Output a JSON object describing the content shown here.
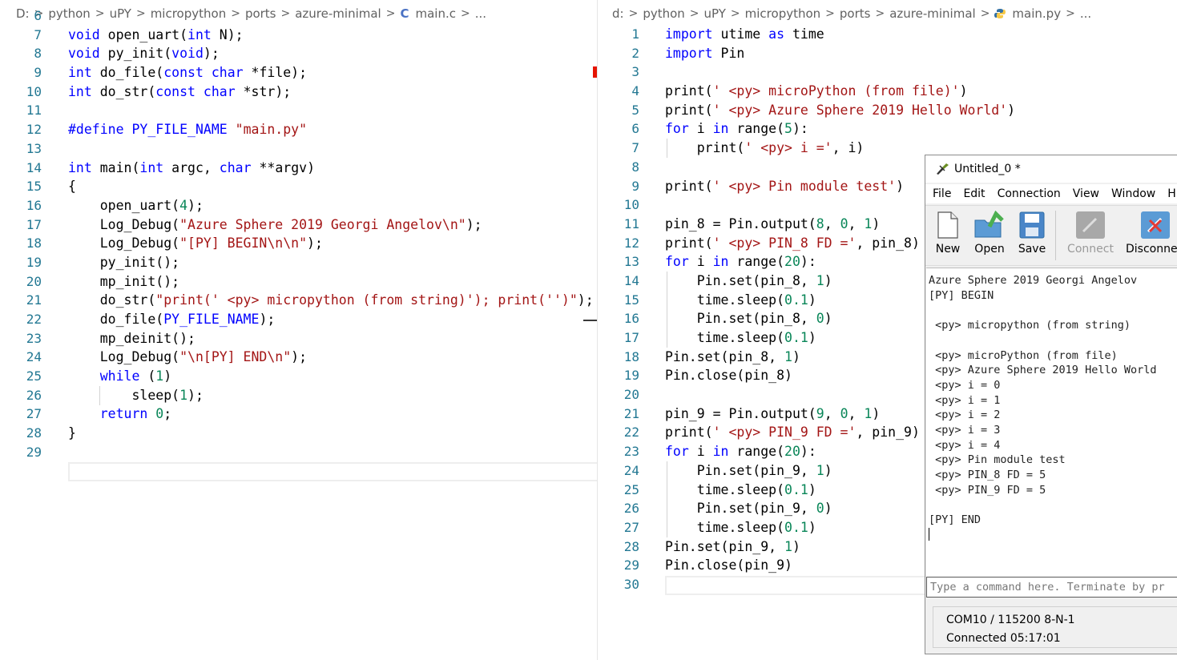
{
  "left": {
    "breadcrumb": [
      "D:",
      "python",
      "uPY",
      "micropython",
      "ports",
      "azure-minimal",
      "main.c",
      "..."
    ],
    "file_icon": "C",
    "lines": [
      {
        "n": "6",
        "t": ""
      },
      {
        "n": "7",
        "t": "void open_uart(int N);"
      },
      {
        "n": "8",
        "t": "void py_init(void);"
      },
      {
        "n": "9",
        "t": "int do_file(const char *file);"
      },
      {
        "n": "10",
        "t": "int do_str(const char *str);"
      },
      {
        "n": "11",
        "t": ""
      },
      {
        "n": "12",
        "t": "#define PY_FILE_NAME \"main.py\""
      },
      {
        "n": "13",
        "t": ""
      },
      {
        "n": "14",
        "t": "int main(int argc, char **argv)"
      },
      {
        "n": "15",
        "t": "{"
      },
      {
        "n": "16",
        "t": "    open_uart(4);"
      },
      {
        "n": "17",
        "t": "    Log_Debug(\"Azure Sphere 2019 Georgi Angelov\\n\");"
      },
      {
        "n": "18",
        "t": "    Log_Debug(\"[PY] BEGIN\\n\\n\");"
      },
      {
        "n": "19",
        "t": "    py_init();"
      },
      {
        "n": "20",
        "t": "    mp_init();"
      },
      {
        "n": "21",
        "t": "    do_str(\"print(' <py> micropython (from string)'); print('')\");"
      },
      {
        "n": "22",
        "t": "    do_file(PY_FILE_NAME);"
      },
      {
        "n": "23",
        "t": "    mp_deinit();"
      },
      {
        "n": "24",
        "t": "    Log_Debug(\"\\n[PY] END\\n\");"
      },
      {
        "n": "25",
        "t": "    while (1)"
      },
      {
        "n": "26",
        "t": "        sleep(1);"
      },
      {
        "n": "27",
        "t": "    return 0;"
      },
      {
        "n": "28",
        "t": "}"
      },
      {
        "n": "29",
        "t": ""
      }
    ]
  },
  "right": {
    "breadcrumb": [
      "d:",
      "python",
      "uPY",
      "micropython",
      "ports",
      "azure-minimal",
      "main.py",
      "..."
    ],
    "lines": [
      {
        "n": "1",
        "t": "import utime as time"
      },
      {
        "n": "2",
        "t": "import Pin"
      },
      {
        "n": "3",
        "t": ""
      },
      {
        "n": "4",
        "t": "print(' <py> microPython (from file)')"
      },
      {
        "n": "5",
        "t": "print(' <py> Azure Sphere 2019 Hello World')"
      },
      {
        "n": "6",
        "t": "for i in range(5):"
      },
      {
        "n": "7",
        "t": "    print(' <py> i =', i)"
      },
      {
        "n": "8",
        "t": ""
      },
      {
        "n": "9",
        "t": "print(' <py> Pin module test')"
      },
      {
        "n": "10",
        "t": ""
      },
      {
        "n": "11",
        "t": "pin_8 = Pin.output(8, 0, 1)"
      },
      {
        "n": "12",
        "t": "print(' <py> PIN_8 FD =', pin_8)"
      },
      {
        "n": "13",
        "t": "for i in range(20):"
      },
      {
        "n": "14",
        "t": "    Pin.set(pin_8, 1)"
      },
      {
        "n": "15",
        "t": "    time.sleep(0.1)"
      },
      {
        "n": "16",
        "t": "    Pin.set(pin_8, 0)"
      },
      {
        "n": "17",
        "t": "    time.sleep(0.1)"
      },
      {
        "n": "18",
        "t": "Pin.set(pin_8, 1)"
      },
      {
        "n": "19",
        "t": "Pin.close(pin_8)"
      },
      {
        "n": "20",
        "t": ""
      },
      {
        "n": "21",
        "t": "pin_9 = Pin.output(9, 0, 1)"
      },
      {
        "n": "22",
        "t": "print(' <py> PIN_9 FD =', pin_9)"
      },
      {
        "n": "23",
        "t": "for i in range(20):"
      },
      {
        "n": "24",
        "t": "    Pin.set(pin_9, 1)"
      },
      {
        "n": "25",
        "t": "    time.sleep(0.1)"
      },
      {
        "n": "26",
        "t": "    Pin.set(pin_9, 0)"
      },
      {
        "n": "27",
        "t": "    time.sleep(0.1)"
      },
      {
        "n": "28",
        "t": "Pin.set(pin_9, 1)"
      },
      {
        "n": "29",
        "t": "Pin.close(pin_9)"
      },
      {
        "n": "30",
        "t": ""
      }
    ]
  },
  "terminal": {
    "title": "Untitled_0 *",
    "menu": [
      "File",
      "Edit",
      "Connection",
      "View",
      "Window",
      "H"
    ],
    "toolbar": {
      "new": "New",
      "open": "Open",
      "save": "Save",
      "connect": "Connect",
      "disconnect": "Disconne"
    },
    "output": "Azure Sphere 2019 Georgi Angelov\n[PY] BEGIN\n\n <py> micropython (from string)\n\n <py> microPython (from file)\n <py> Azure Sphere 2019 Hello World\n <py> i = 0\n <py> i = 1\n <py> i = 2\n <py> i = 3\n <py> i = 4\n <py> Pin module test\n <py> PIN_8 FD = 5\n <py> PIN_9 FD = 5\n\n[PY] END\n",
    "input_placeholder": "Type a command here. Terminate by pr",
    "status_port": "COM10 / 115200 8-N-1",
    "status_conn": "Connected 05:17:01"
  },
  "icons": {
    "c_file": "c-file-icon",
    "py_file": "python-file-icon",
    "app": "terminal-app-icon"
  }
}
